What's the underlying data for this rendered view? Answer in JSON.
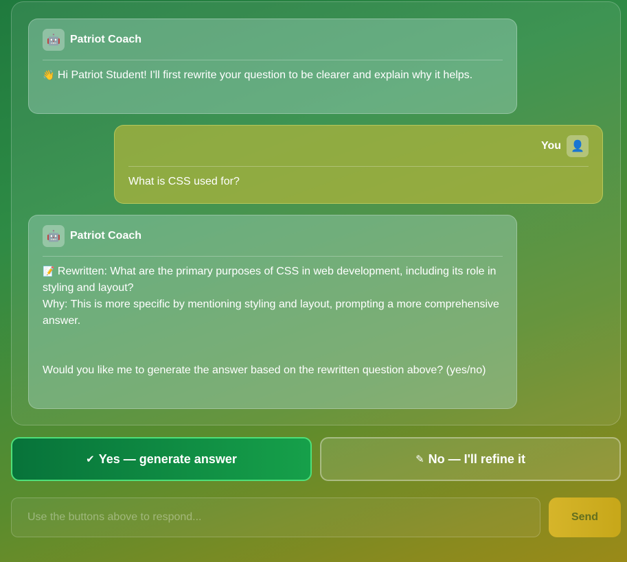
{
  "messages": [
    {
      "sender": "Patriot Coach",
      "avatar_icon": "robot-icon",
      "emoji": "👋",
      "text": "Hi Patriot Student! I'll first rewrite your question to be clearer and explain why it helps."
    },
    {
      "sender": "You",
      "avatar_icon": "user-icon",
      "text": "What is CSS used for?"
    },
    {
      "sender": "Patriot Coach",
      "avatar_icon": "robot-icon",
      "emoji": "📝",
      "rewritten": "Rewritten: What are the primary purposes of CSS in web development, including its role in styling and layout?",
      "why": "Why: This is more specific by mentioning styling and layout, prompting a more comprehensive answer.",
      "question": "Would you like me to generate the answer based on the rewritten question above? (yes/no)"
    }
  ],
  "actions": {
    "yes_icon": "check-icon",
    "yes_label": "Yes — generate answer",
    "no_icon": "pencil-icon",
    "no_label": "No — I'll refine it"
  },
  "composer": {
    "placeholder": "Use the buttons above to respond...",
    "send_label": "Send"
  },
  "colors": {
    "yes_button": "#16a04a",
    "send_button": "#d6b52a",
    "you_bubble": "#a6ae3c"
  }
}
